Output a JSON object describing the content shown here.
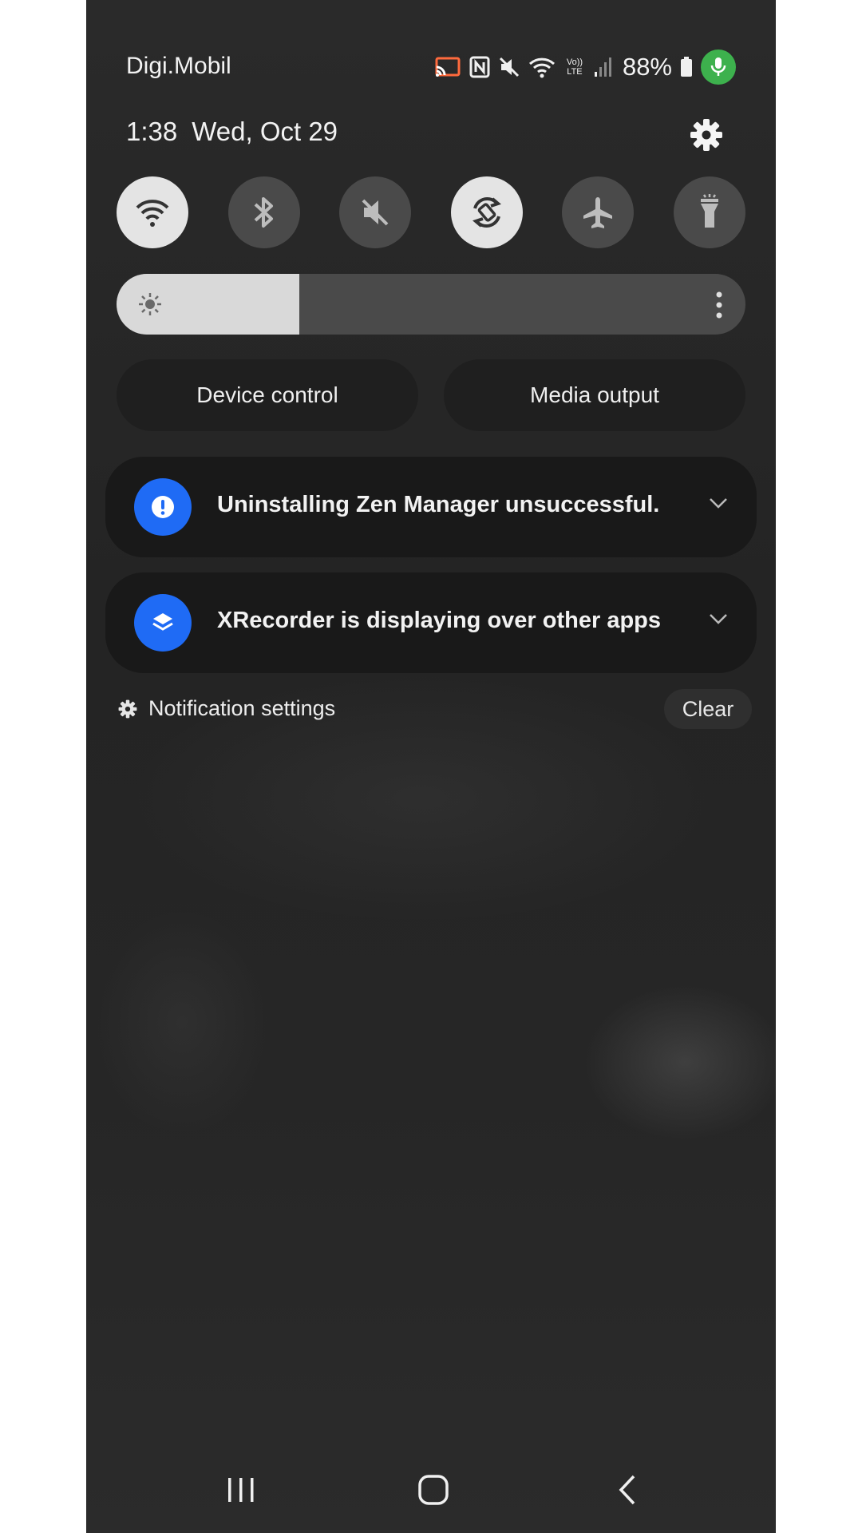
{
  "status_bar": {
    "carrier": "Digi.Mobil",
    "battery": "88%",
    "icons": [
      "cast-icon",
      "nfc-icon",
      "mute-icon",
      "wifi-icon",
      "volte-lte-icon",
      "signal-icon",
      "battery-icon",
      "mic-active-icon"
    ],
    "volte_label": "Vo)) LTE"
  },
  "header": {
    "time": "1:38",
    "date": "Wed, Oct 29"
  },
  "quick_toggles": [
    {
      "name": "wifi",
      "state": "on",
      "icon": "wifi-icon"
    },
    {
      "name": "bluetooth",
      "state": "off",
      "icon": "bluetooth-icon"
    },
    {
      "name": "sound",
      "state": "off",
      "icon": "mute-icon"
    },
    {
      "name": "auto-rotate",
      "state": "on",
      "icon": "rotate-icon"
    },
    {
      "name": "airplane",
      "state": "off",
      "icon": "airplane-icon"
    },
    {
      "name": "flashlight",
      "state": "off",
      "icon": "flashlight-icon"
    }
  ],
  "brightness": {
    "level": 0.29
  },
  "buttons": {
    "device_control": "Device control",
    "media_output": "Media output"
  },
  "notifications": [
    {
      "text": "Uninstalling Zen Manager unsuccessful.",
      "icon": "alert-icon"
    },
    {
      "text": "XRecorder is displaying over other apps",
      "icon": "layers-icon"
    }
  ],
  "footer": {
    "settings_label": "Notification settings",
    "clear_label": "Clear"
  },
  "colors": {
    "background": "#262626",
    "toggle_on": "#e4e4e4",
    "toggle_off": "#4a4a4a",
    "notif_accent": "#1f6bf5",
    "mic_green": "#3db14d"
  }
}
